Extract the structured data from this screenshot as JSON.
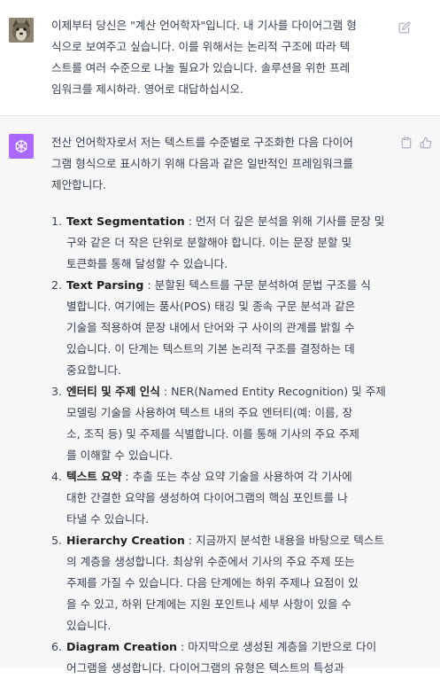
{
  "user_message": {
    "lines": [
      "이제부터 당신은 \"계산 언어학자\"입니다. 내 기사를 다이어그램 형",
      "식으로 보여주고 싶습니다. 이를 위해서는 논리적 구조에 따라 텍",
      "스트를 여러 수준으로 나눌 필요가 있습니다. 솔루션을 위한 프레",
      "임워크를 제시하라. 영어로 대답하십시오."
    ]
  },
  "assistant_message": {
    "intro_lines": [
      "전산 언어학자로서 저는 텍스트를 수준별로 구조화한 다음 다이어",
      "그램 형식으로 표시하기 위해 다음과 같은 일반적인 프레임워크를",
      "제안합니다."
    ],
    "items": [
      {
        "num": "1.",
        "title": "Text Segmentation",
        "first": " : 먼저 더 깊은 분석을 위해 기사를 문장 및",
        "rest": [
          "구와 같은 더 작은 단위로 분할해야 합니다. 이는 문장 분할 및",
          "토큰화를 통해 달성할 수 있습니다."
        ]
      },
      {
        "num": "2.",
        "title": "Text Parsing",
        "first": " : 분할된 텍스트를 구문 분석하여 문법 구조를 식",
        "rest": [
          "별합니다. 여기에는 품사(POS) 태깅 및 종속 구문 분석과 같은",
          "기술을 적용하여 문장 내에서 단어와 구 사이의 관계를 밝힐 수",
          "있습니다. 이 단계는 텍스트의 기본 논리적 구조를 결정하는 데",
          "중요합니다."
        ]
      },
      {
        "num": "3.",
        "title": "엔터티 및 주제 인식",
        "first": " : NER(Named Entity Recognition) 및 주제",
        "rest": [
          "모델링 기술을 사용하여 텍스트 내의 주요 엔터티(예: 이름, 장",
          "소, 조직 등) 및 주제를 식별합니다. 이를 통해 기사의 주요 주제",
          "를 이해할 수 있습니다."
        ]
      },
      {
        "num": "4.",
        "title": "텍스트 요약",
        "first": " : 추출 또는 추상 요약 기술을 사용하여 각 기사에",
        "rest": [
          "대한 간결한 요약을 생성하여 다이어그램의 핵심 포인트를 나",
          "타낼 수 있습니다."
        ]
      },
      {
        "num": "5.",
        "title": "Hierarchy Creation",
        "first": " : 지금까지 분석한 내용을 바탕으로 텍스트",
        "rest": [
          "의 계층을 생성합니다. 최상위 수준에서 기사의 주요 주제 또는",
          "주제를 가질 수 있습니다. 다음 단계에는 하위 주제나 요점이 있",
          "을 수 있고, 하위 단계에는 지원 포인트나 세부 사항이 있을 수",
          "있습니다."
        ]
      },
      {
        "num": "6.",
        "title": "Diagram Creation",
        "first": " : 마지막으로 생성된 계층을 기반으로 다이",
        "rest": [
          "어그램을 생성합니다. 다이어그램의 유형은 텍스트의 특성과"
        ]
      }
    ]
  },
  "icons": {
    "edit": "edit-icon",
    "copy": "clipboard-icon",
    "thumb": "thumbs-up-icon",
    "bot": "openai-logo-icon",
    "user": "user-avatar-image"
  },
  "colors": {
    "bot_avatar": "#ab68ff",
    "assistant_bg": "#f7f7f8"
  }
}
